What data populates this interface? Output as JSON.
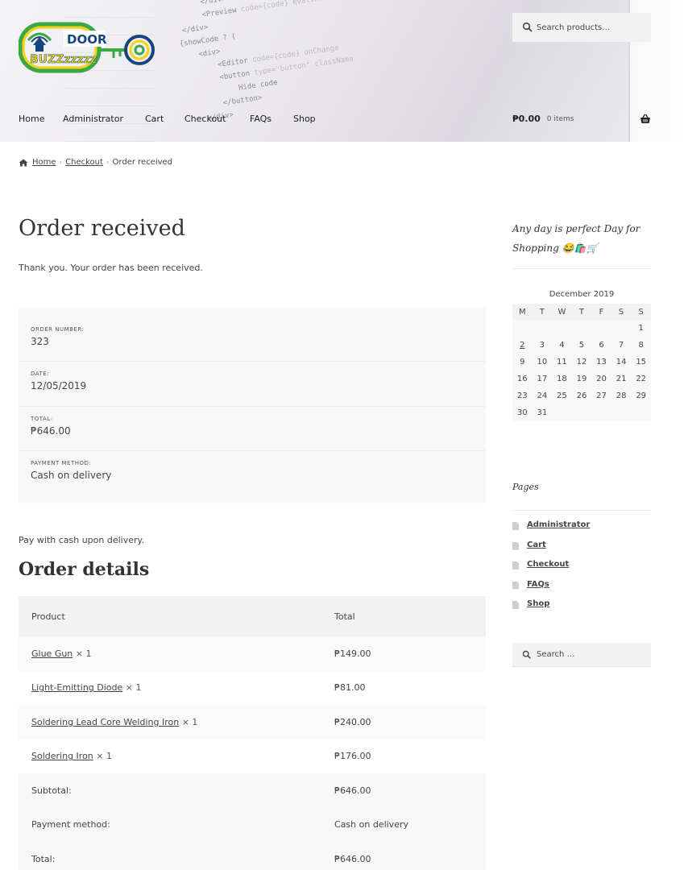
{
  "header": {
    "logo_word1": "DOOR",
    "logo_word2": "BUZZzzzzz",
    "search_placeholder": "Search products…",
    "nav": [
      "Home",
      "Administrator",
      "Cart",
      "Checkout",
      "FAQs",
      "Shop"
    ],
    "cart_amount": "₱0.00",
    "cart_items": "0 items"
  },
  "breadcrumb": [
    "Home",
    "Checkout",
    "Order received"
  ],
  "main": {
    "title": "Order received",
    "thanks": "Thank you. Your order has been received.",
    "overview": [
      {
        "label": "ORDER NUMBER:",
        "value": "323"
      },
      {
        "label": "DATE:",
        "value": "12/05/2019"
      },
      {
        "label": "TOTAL:",
        "value": "₱646.00"
      },
      {
        "label": "PAYMENT METHOD:",
        "value": "Cash on delivery"
      }
    ],
    "pay_note": "Pay with cash upon delivery.",
    "details_title": "Order details",
    "table_headers": [
      "Product",
      "Total"
    ],
    "items": [
      {
        "name": "Glue Gun",
        "qty": "× 1",
        "total": "₱149.00"
      },
      {
        "name": "Light-Emitting Diode",
        "qty": "× 1",
        "total": "₱81.00"
      },
      {
        "name": "Soldering Lead Core Welding Iron",
        "qty": "× 1",
        "total": "₱240.00"
      },
      {
        "name": "Soldering Iron",
        "qty": "× 1",
        "total": "₱176.00"
      }
    ],
    "footer_rows": [
      {
        "label": "Subtotal:",
        "value": "₱646.00"
      },
      {
        "label": "Payment method:",
        "value": "Cash on delivery"
      },
      {
        "label": "Total:",
        "value": "₱646.00"
      }
    ]
  },
  "sidebar": {
    "tagline": "Any day is perfect Day for Shopping 😂🛍️🛒",
    "calendar": {
      "caption": "December 2019",
      "weekdays": [
        "M",
        "T",
        "W",
        "T",
        "F",
        "S",
        "S"
      ],
      "weeks": [
        [
          "",
          "",
          "",
          "",
          "",
          "",
          "1"
        ],
        [
          "2",
          "3",
          "4",
          "5",
          "6",
          "7",
          "8"
        ],
        [
          "9",
          "10",
          "11",
          "12",
          "13",
          "14",
          "15"
        ],
        [
          "16",
          "17",
          "18",
          "19",
          "20",
          "21",
          "22"
        ],
        [
          "23",
          "24",
          "25",
          "26",
          "27",
          "28",
          "29"
        ],
        [
          "30",
          "31",
          "",
          "",
          "",
          "",
          ""
        ]
      ],
      "linked_day": "2"
    },
    "pages_title": "Pages",
    "pages": [
      "Administrator",
      "Cart",
      "Checkout",
      "FAQs",
      "Shop"
    ],
    "search_placeholder": "Search …"
  },
  "colors": {
    "text": "#43454b",
    "logo_blue": "#17447e",
    "logo_yellow": "#f5d10f",
    "logo_green": "#3aa845",
    "table_head": "#f2f2f2"
  },
  "icons": {
    "search": "search-icon",
    "cart": "basket-icon",
    "home": "home-icon",
    "page": "document-icon"
  }
}
